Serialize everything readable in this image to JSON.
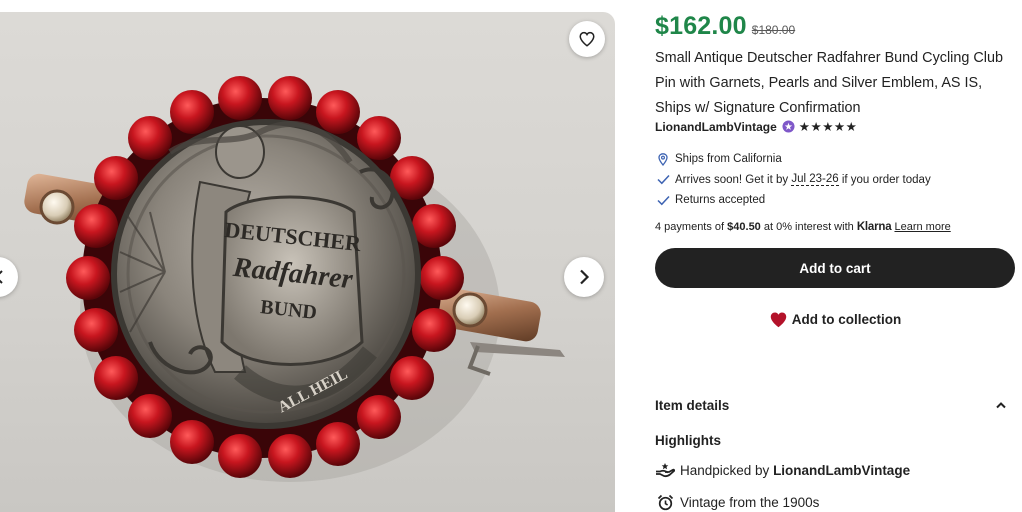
{
  "listing": {
    "price": "$162.00",
    "original_price": "$180.00",
    "title": "Small Antique Deutscher Radfahrer Bund Cycling Club Pin with Garnets, Pearls and Silver Emblem, AS IS, Ships w/ Signature Confirmation",
    "shop_name": "LionandLambVintage",
    "rating_stars": "★★★★★"
  },
  "image": {
    "emblem_text_1": "DEUTSCHER",
    "emblem_text_2": "Radfahrer",
    "emblem_text_3": "BUND",
    "emblem_text_4": "ALL HEIL"
  },
  "shipping": {
    "ships_from": "Ships from California",
    "arrives_prefix": "Arrives soon! Get it by ",
    "arrives_dates": "Jul 23-26",
    "arrives_suffix": " if you order today",
    "returns": "Returns accepted"
  },
  "klarna": {
    "prefix": "4 payments of ",
    "amount": "$40.50",
    "middle": " at 0% interest with ",
    "brand": "Klarna",
    "learn_more": "Learn more"
  },
  "actions": {
    "add_to_cart": "Add to cart",
    "add_to_collection": "Add to collection"
  },
  "details": {
    "header": "Item details",
    "highlights_label": "Highlights",
    "handpicked_prefix": "Handpicked by ",
    "handpicked_shop": "LionandLambVintage",
    "vintage": "Vintage from the 1900s"
  },
  "icons": {
    "favorite": "heart-outline-icon",
    "next": "chevron-right-icon",
    "prev": "chevron-left-icon",
    "star_seller": "star-seller-badge-icon",
    "location": "location-pin-icon",
    "check": "check-icon",
    "collection": "heart-filled-icon",
    "collapse": "chevron-up-icon",
    "handpicked": "hand-icon",
    "vintage": "alarm-clock-icon"
  },
  "colors": {
    "price": "#1f8649",
    "button": "#222222",
    "heart": "#b3122a",
    "star_seller_badge": "#7f58c9",
    "check": "#3d63b2"
  }
}
